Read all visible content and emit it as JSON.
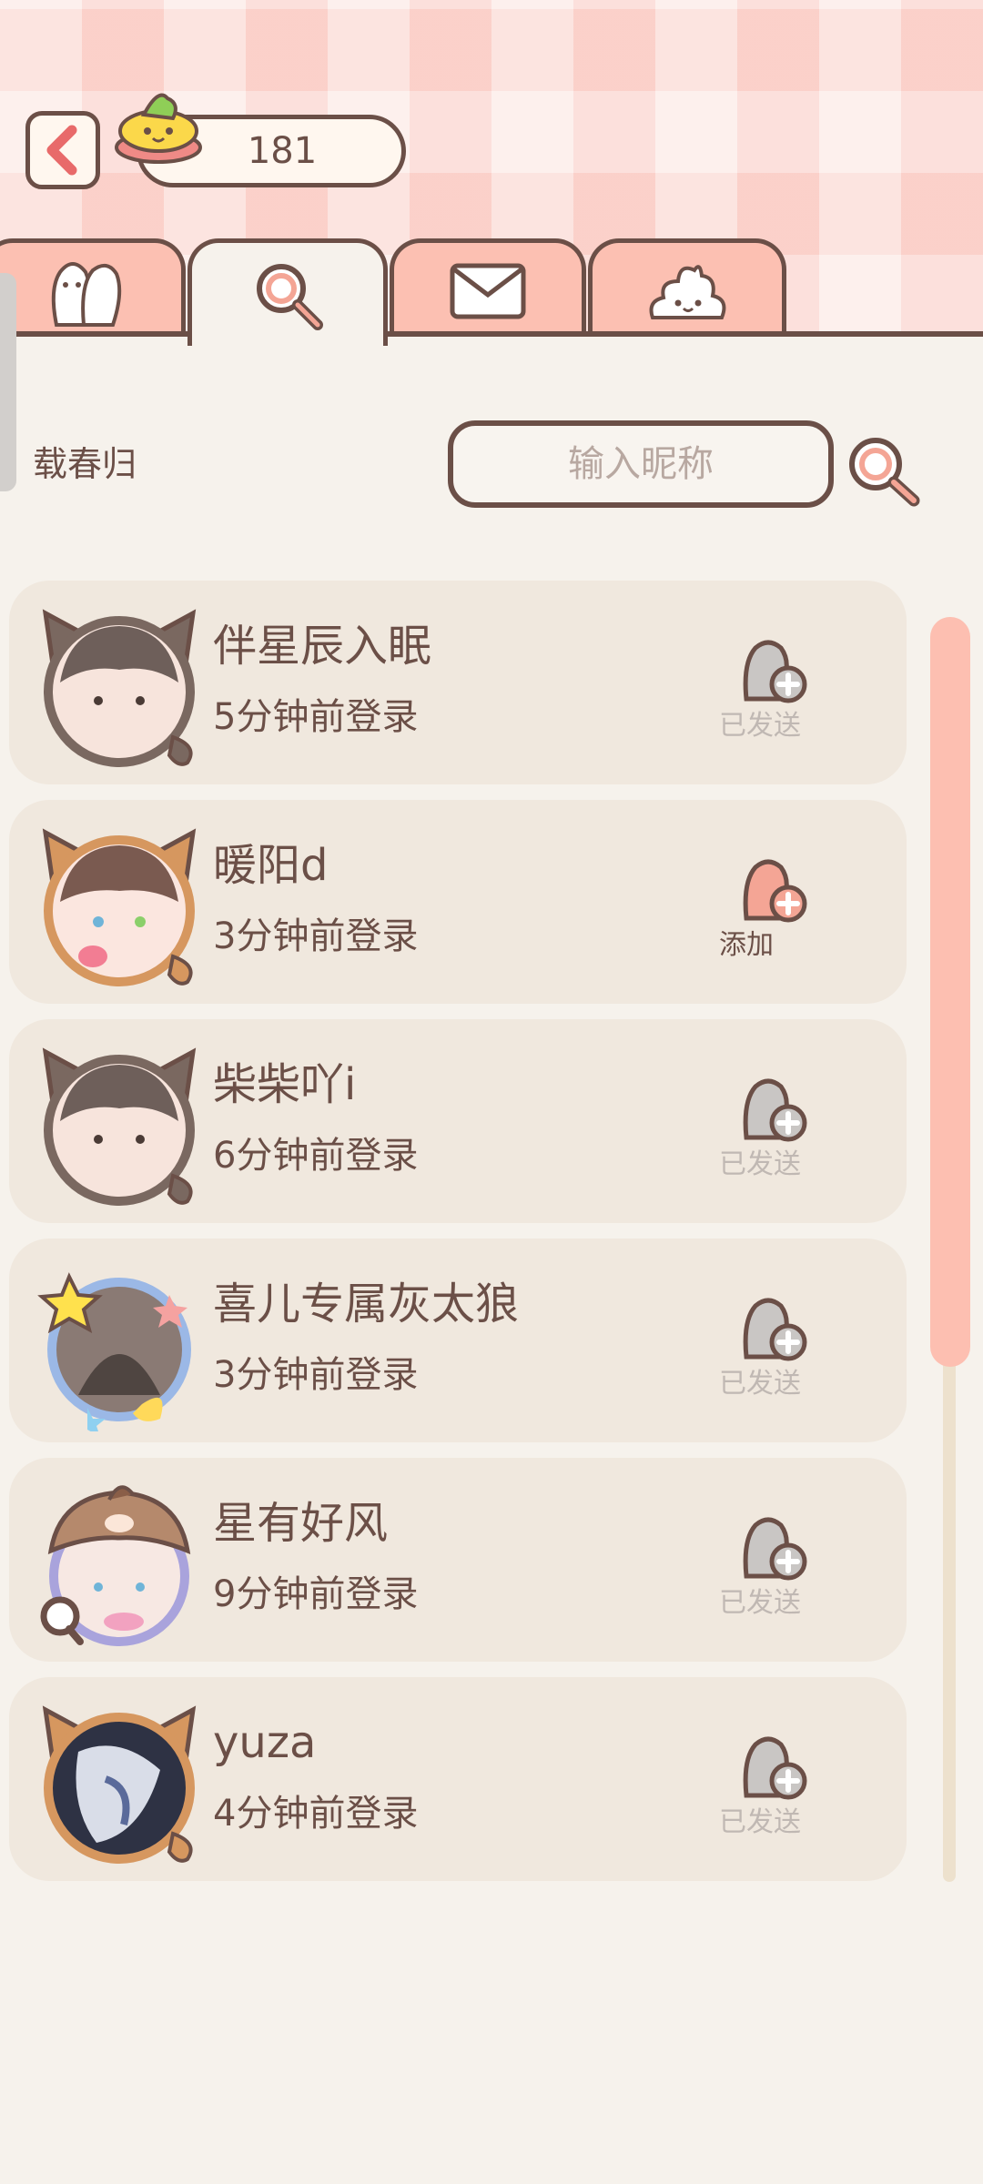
{
  "header": {
    "coin_count": "181",
    "back_icon": "chevron-left-icon",
    "coin_icon": "poop-coin-icon"
  },
  "tabs": [
    {
      "icon": "friends-icon",
      "active": false
    },
    {
      "icon": "search-icon",
      "active": true
    },
    {
      "icon": "mail-icon",
      "active": false
    },
    {
      "icon": "poop-icon",
      "active": false
    }
  ],
  "search": {
    "label": "载春归",
    "placeholder": "输入昵称",
    "button_icon": "search-icon"
  },
  "users": [
    {
      "name": "伴星辰入眠",
      "login": "5分钟前登录",
      "action": "已发送",
      "status": "sent"
    },
    {
      "name": "暖阳d",
      "login": "3分钟前登录",
      "action": "添加",
      "status": "add"
    },
    {
      "name": "柴柴吖i",
      "login": "6分钟前登录",
      "action": "已发送",
      "status": "sent"
    },
    {
      "name": "喜儿专属灰太狼",
      "login": "3分钟前登录",
      "action": "已发送",
      "status": "sent"
    },
    {
      "name": "星有好风",
      "login": "9分钟前登录",
      "action": "已发送",
      "status": "sent"
    },
    {
      "name": "yuza",
      "login": "4分钟前登录",
      "action": "已发送",
      "status": "sent"
    }
  ],
  "colors": {
    "accent": "#fcc0b2",
    "outline": "#6b4f47",
    "row_bg": "#f0e8de",
    "sent_icon": "#c9c6c4",
    "add_icon": "#f4a595"
  }
}
